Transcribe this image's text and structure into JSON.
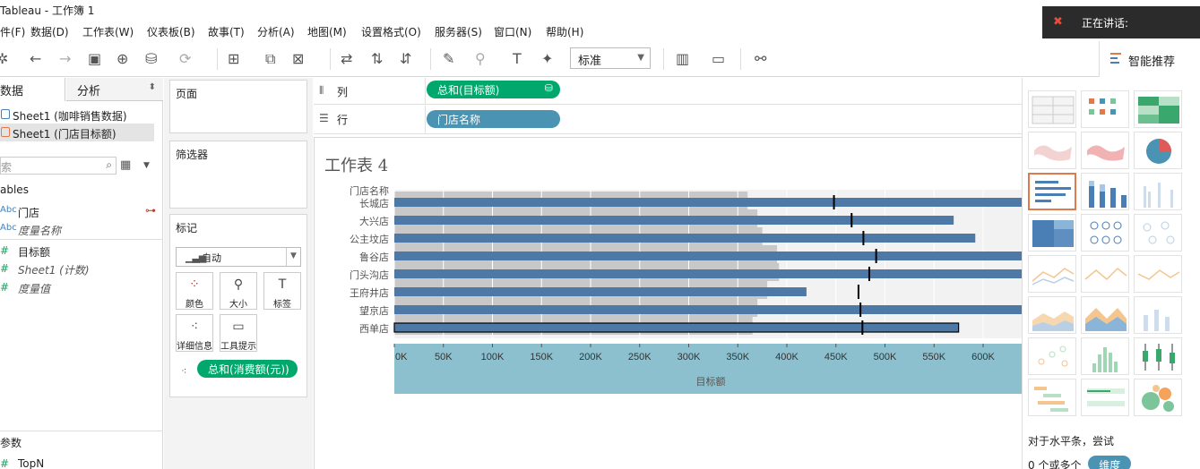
{
  "app": {
    "title": "Tableau - 工作簿 1"
  },
  "notification": {
    "label": "正在讲话:"
  },
  "menu": [
    "件(F)",
    "数据(D)",
    "工作表(W)",
    "仪表板(B)",
    "故事(T)",
    "分析(A)",
    "地图(M)",
    "设置格式(O)",
    "服务器(S)",
    "窗口(N)",
    "帮助(H)"
  ],
  "toolbar": {
    "fit_select": "标准",
    "smart_button": "智能推荐"
  },
  "datapane": {
    "tab_data": "数据",
    "tab_analysis": "分析",
    "sources": [
      "Sheet1 (咖啡销售数据)",
      "Sheet1 (门店目标额)"
    ],
    "search_placeholder": "索",
    "tables_header": "ables",
    "dimensions": [
      {
        "type": "Abc",
        "name": "门店"
      },
      {
        "type": "Abc",
        "name": "度量名称"
      }
    ],
    "measures": [
      {
        "type": "#",
        "name": "目标额"
      },
      {
        "type": "#",
        "name": "Sheet1 (计数)"
      },
      {
        "type": "#",
        "name": "度量值"
      }
    ],
    "params_header": "参数",
    "params": [
      {
        "type": "#",
        "name": "TopN"
      }
    ]
  },
  "shelves": {
    "pages": "页面",
    "filters": "筛选器",
    "marks": "标记",
    "marks_type": "自动",
    "mark_buttons": [
      "颜色",
      "大小",
      "标签",
      "详细信息",
      "工具提示"
    ],
    "marks_pill": "总和(消费额(元))",
    "columns_label": "列",
    "rows_label": "行",
    "column_pill": "总和(目标额)",
    "row_pill": "门店名称"
  },
  "view": {
    "sheet_title": "工作表 4"
  },
  "chart_data": {
    "type": "bar",
    "row_header": "门店名称",
    "categories": [
      "长城店",
      "大兴店",
      "公主坟店",
      "鲁谷店",
      "门头沟店",
      "王府井店",
      "望京店",
      "西单店"
    ],
    "series": [
      {
        "name": "目标额",
        "values": [
          655000,
          570000,
          592000,
          660000,
          640000,
          420000,
          660000,
          575000
        ]
      }
    ],
    "reference_lines": [
      448000,
      466000,
      478000,
      491000,
      484000,
      473000,
      475000,
      477000
    ],
    "background_bands": [
      360000,
      370000,
      375000,
      390000,
      392000,
      380000,
      370000,
      365000
    ],
    "xlabel": "目标额",
    "xticks": [
      "0K",
      "50K",
      "100K",
      "150K",
      "200K",
      "250K",
      "300K",
      "350K",
      "400K",
      "450K",
      "500K",
      "550K",
      "600K"
    ],
    "xlim": [
      0,
      640000
    ],
    "colors": {
      "bar": "#4e79a7",
      "axis_band": "#8cc0cf",
      "band": "#c8c8c8",
      "ref": "#000000"
    }
  },
  "showme": {
    "hint_line1": "对于水平条，尝试",
    "hint_line2": "0 个或多个",
    "hint_pill": "维度"
  }
}
